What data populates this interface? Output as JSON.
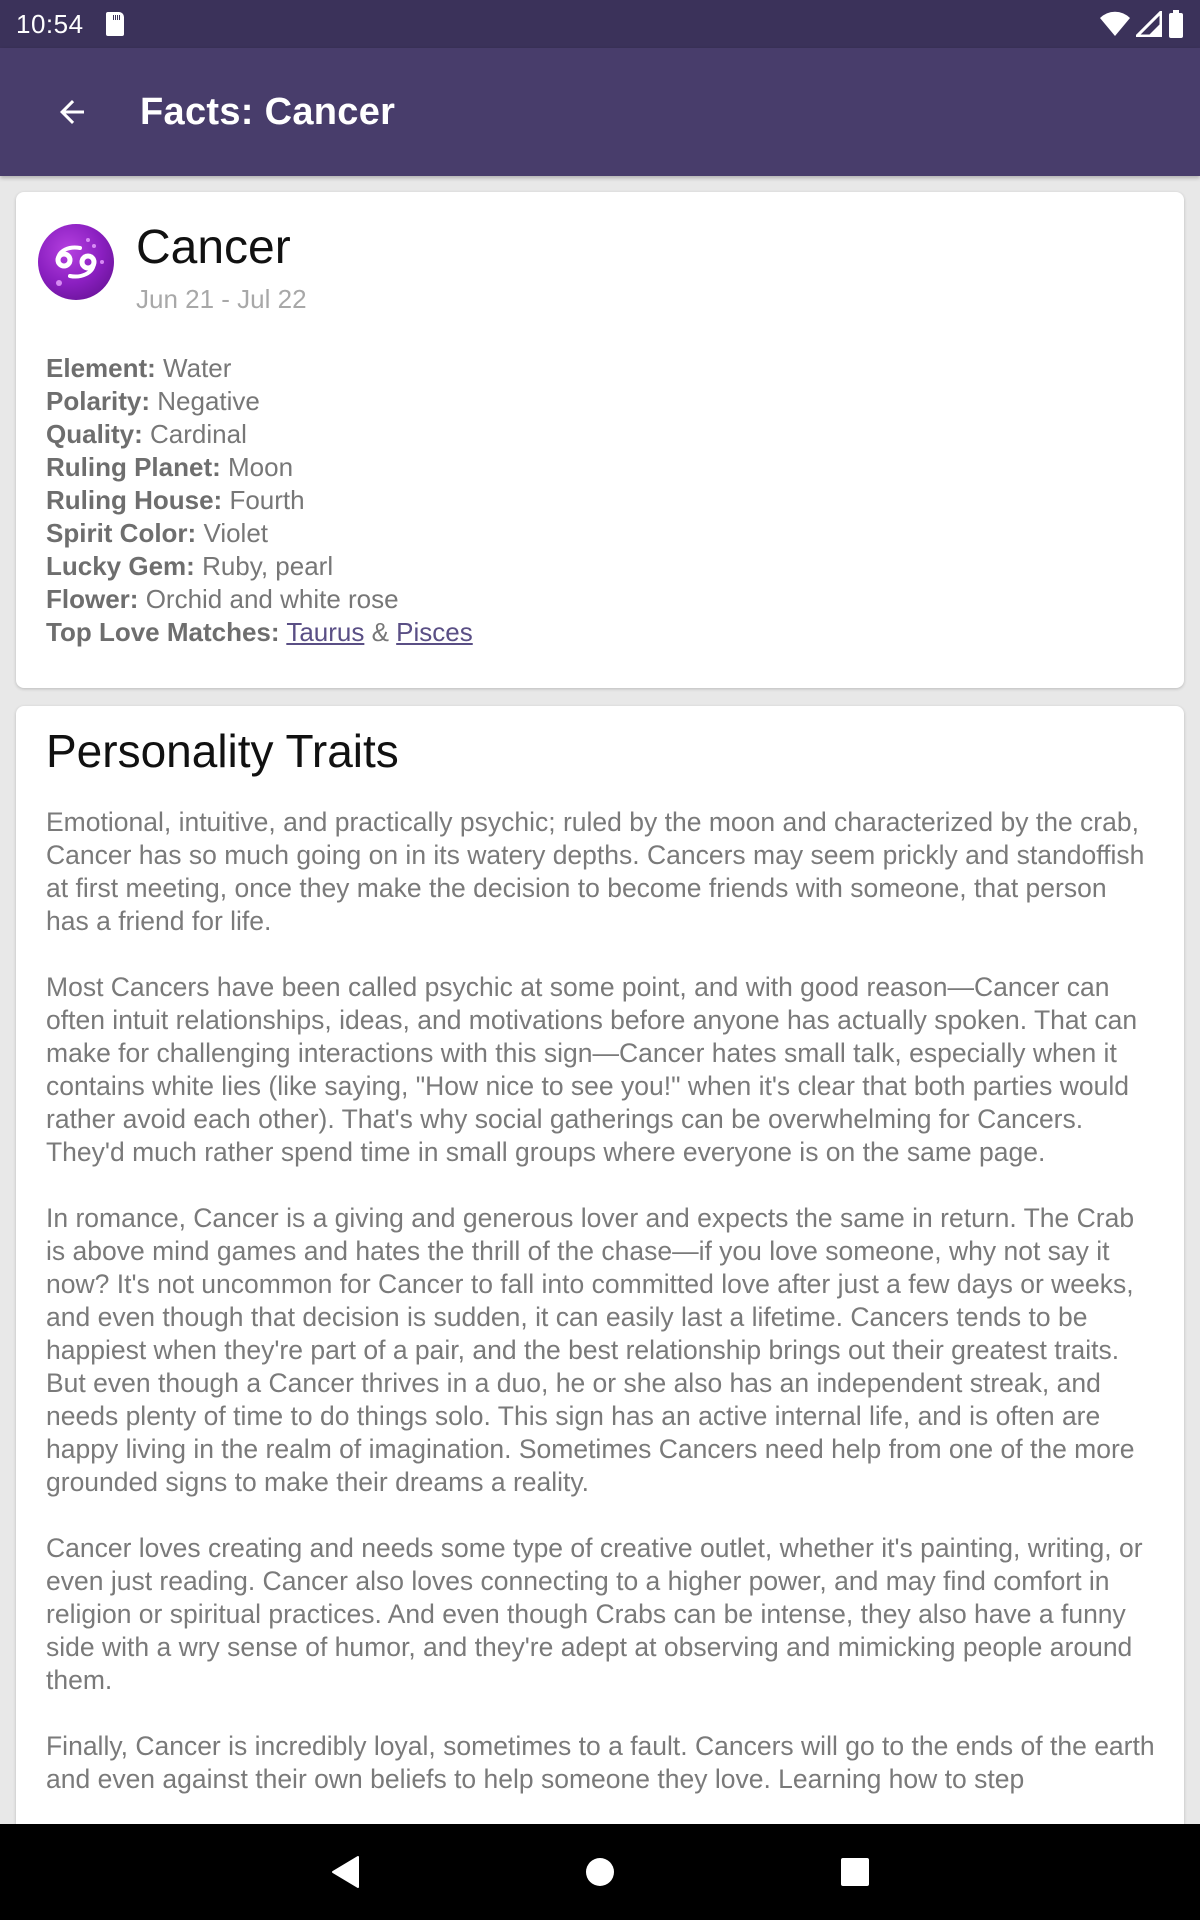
{
  "status_bar": {
    "time": "10:54",
    "icons": [
      "sd-card-icon",
      "wifi-icon",
      "signal-icon",
      "battery-icon"
    ]
  },
  "app_bar": {
    "back_icon": "arrow-left-icon",
    "title": "Facts: Cancer"
  },
  "sign": {
    "icon": "cancer-zodiac-icon",
    "glyph": "♋",
    "name": "Cancer",
    "dates": "Jun 21 - Jul 22",
    "facts": [
      {
        "label": "Element:",
        "value": "Water"
      },
      {
        "label": "Polarity:",
        "value": "Negative"
      },
      {
        "label": "Quality:",
        "value": "Cardinal"
      },
      {
        "label": "Ruling Planet:",
        "value": "Moon"
      },
      {
        "label": "Ruling House:",
        "value": "Fourth"
      },
      {
        "label": "Spirit Color:",
        "value": "Violet"
      },
      {
        "label": "Lucky Gem:",
        "value": "Ruby, pearl"
      },
      {
        "label": "Flower:",
        "value": "Orchid and white rose"
      }
    ],
    "love_matches": {
      "label": "Top Love Matches:",
      "match1": "Taurus",
      "separator": "&",
      "match2": "Pisces"
    }
  },
  "traits": {
    "title": "Personality Traits",
    "paragraphs": [
      "Emotional, intuitive, and practically psychic; ruled by the moon and characterized by the crab, Cancer has so much going on in its watery depths. Cancers may seem prickly and standoffish at first meeting, once they make the decision to become friends with someone, that person has a friend for life.",
      "Most Cancers have been called psychic at some point, and with good reason—Cancer can often intuit relationships, ideas, and motivations before anyone has actually spoken. That can make for challenging interactions with this sign—Cancer hates small talk, especially when it contains white lies (like saying, \"How nice to see you!\" when it's clear that both parties would rather avoid each other). That's why social gatherings can be overwhelming for Cancers. They'd much rather spend time in small groups where everyone is on the same page.",
      "In romance, Cancer is a giving and generous lover and expects the same in return. The Crab is above mind games and hates the thrill of the chase—if you love someone, why not say it now? It's not uncommon for Cancer to fall into committed love after just a few days or weeks, and even though that decision is sudden, it can easily last a lifetime. Cancers tends to be happiest when they're part of a pair, and the best relationship brings out their greatest traits. But even though a Cancer thrives in a duo, he or she also has an independent streak, and needs plenty of time to do things solo. This sign has an active internal life, and is often are happy living in the realm of imagination. Sometimes Cancers need help from one of the more grounded signs to make their dreams a reality.",
      "Cancer loves creating and needs some type of creative outlet, whether it's painting, writing, or even just reading. Cancer also loves connecting to a higher power, and may find comfort in religion or spiritual practices. And even though Crabs can be intense, they also have a funny side with a wry sense of humor, and they're adept at observing and mimicking people around them.",
      "Finally, Cancer is incredibly loyal, sometimes to a fault. Cancers will go to the ends of the earth and even against their own beliefs to help someone they love. Learning how to step"
    ]
  },
  "nav_bar": {
    "buttons": [
      "back-triangle-icon",
      "home-circle-icon",
      "recents-square-icon"
    ]
  },
  "colors": {
    "status_bar": "#3b325a",
    "app_bar": "#483d6b",
    "link": "#5a4f85",
    "background": "#e8e8e8"
  }
}
